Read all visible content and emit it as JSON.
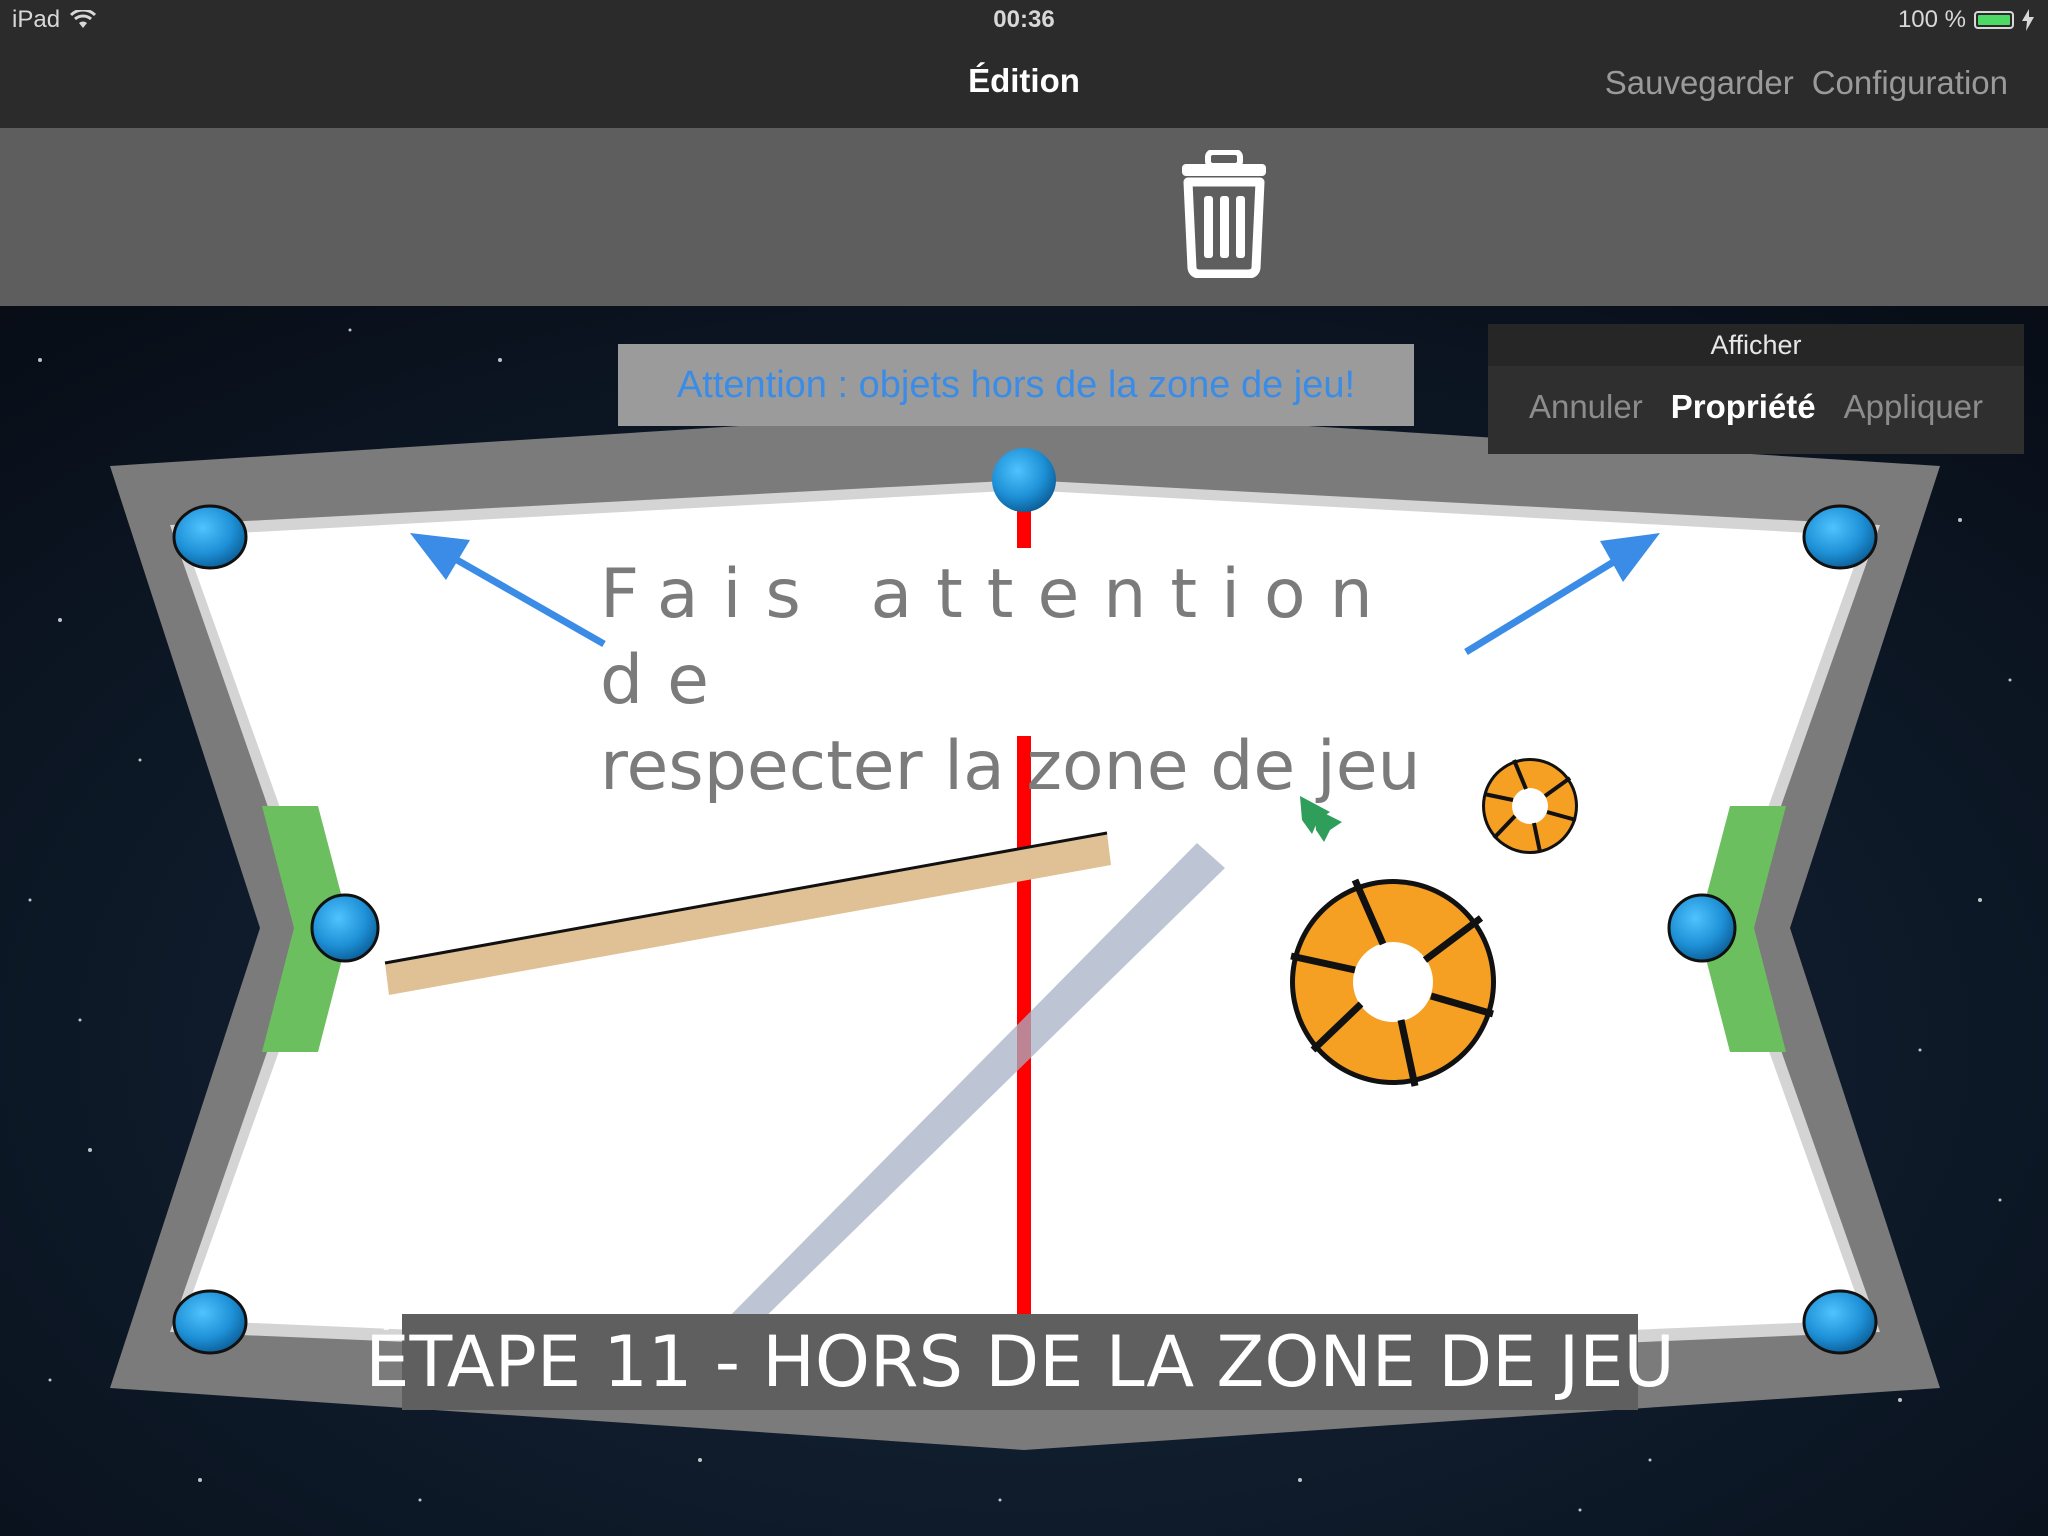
{
  "status_bar": {
    "device": "iPad",
    "time": "00:36",
    "battery": "100 %",
    "battery_level": 1.0
  },
  "nav": {
    "title": "Édition",
    "save_label": "Sauvegarder",
    "config_label": "Configuration"
  },
  "toolbar": {
    "delete_icon": "trash-icon"
  },
  "warning_banner": "Attention : objets hors de la zone de jeu!",
  "properties_panel": {
    "header": "Afficher",
    "cancel_label": "Annuler",
    "property_label": "Propriété",
    "apply_label": "Appliquer"
  },
  "tutorial": {
    "line1": "Fais attention de",
    "line2": "respecter la zone de jeu",
    "stage": "ÉTAPE 11 - HORS DE LA ZONE DE JEU"
  },
  "colors": {
    "bar_bg": "#2b2b2b",
    "toolbar_bg": "#5e5e5e",
    "field": "#ffffff",
    "border": "#7a7a7a",
    "goal": "#6cbf5e",
    "center_line": "#ff0000",
    "puck_blue": "#1e90d6",
    "portal_orange": "#f5a023",
    "plank": "#e0c095",
    "arrow": "#3b8ce6"
  }
}
